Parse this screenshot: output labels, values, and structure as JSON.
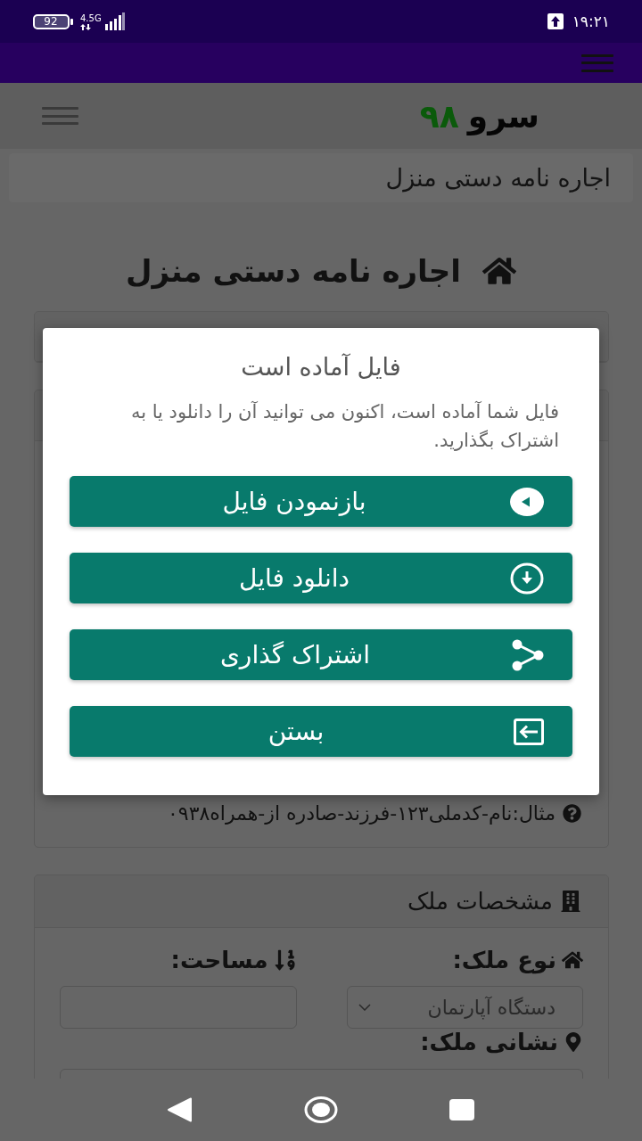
{
  "status_bar": {
    "battery": "92",
    "network": "4.5G",
    "time": "۱۹:۲۱"
  },
  "header": {
    "logo": {
      "name": "سرو",
      "number": "۹۸"
    }
  },
  "breadcrumb": {
    "current": "اجاره نامه دستی منزل"
  },
  "page_title": "اجاره نامه دستی منزل",
  "form": {
    "hint": "مثال:نام-کدملی۱۲۳-فرزند-صادره از-همراه۰۹۳۸",
    "property_section": {
      "title": "مشخصات ملک",
      "property_type": {
        "label": "نوع ملک:",
        "value": "دستگاه آپارتمان"
      },
      "area": {
        "label": "مساحت:"
      },
      "address": {
        "label": "نشانی ملک:"
      }
    }
  },
  "dialog": {
    "title": "فایل آماده است",
    "message": "فایل شما آماده است، اکنون می توانید آن را دانلود یا به اشتراک بگذارید.",
    "buttons": [
      {
        "kind": "open",
        "label": "بازنمودن فایل"
      },
      {
        "kind": "download",
        "label": "دانلود فایل"
      },
      {
        "kind": "share",
        "label": "اشتراک گذاری"
      },
      {
        "kind": "close",
        "label": "بستن"
      }
    ]
  }
}
